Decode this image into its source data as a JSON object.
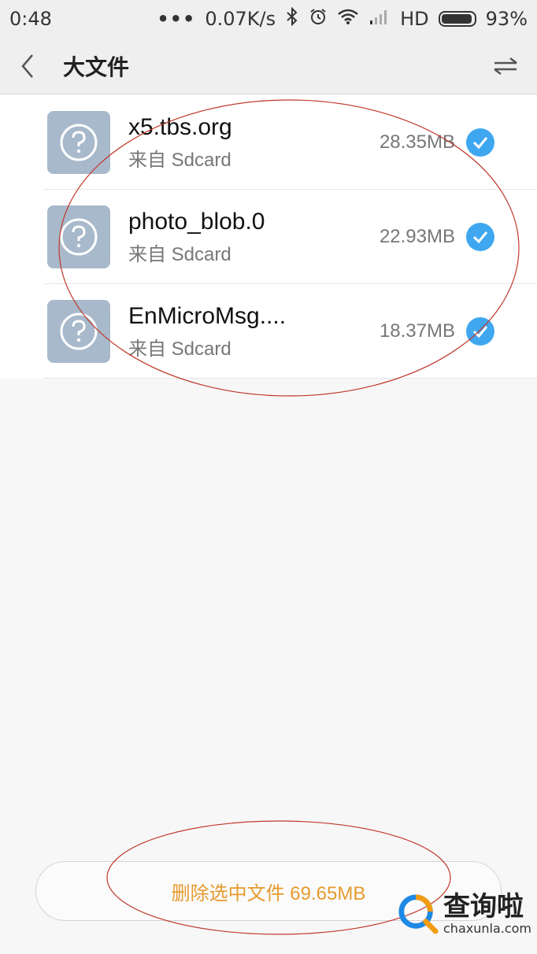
{
  "status_bar": {
    "time": "0:48",
    "dots": "•••",
    "speed": "0.07K/s",
    "network": "HD",
    "battery": "93%",
    "icons": [
      "bluetooth-icon",
      "alarm-icon",
      "wifi-icon",
      "signal-icon",
      "battery-icon"
    ]
  },
  "header": {
    "title": "大文件",
    "icons": [
      "back-icon",
      "sort-icon"
    ]
  },
  "files": [
    {
      "name": "x5.tbs.org",
      "source": "来自 Sdcard",
      "size": "28.35MB",
      "checked": true
    },
    {
      "name": "photo_blob.0",
      "source": "来自 Sdcard",
      "size": "22.93MB",
      "checked": true
    },
    {
      "name": "EnMicroMsg....",
      "source": "来自 Sdcard",
      "size": "18.37MB",
      "checked": true
    }
  ],
  "action": {
    "delete_label": "删除选中文件 69.65MB"
  },
  "watermark": {
    "cn": "查询啦",
    "en": "chaxunla.com"
  },
  "colors": {
    "accent": "#3fa7f0",
    "delete_text": "#e69a2e",
    "file_icon_bg": "#a8b9cb",
    "annotation": "#c0392b"
  }
}
